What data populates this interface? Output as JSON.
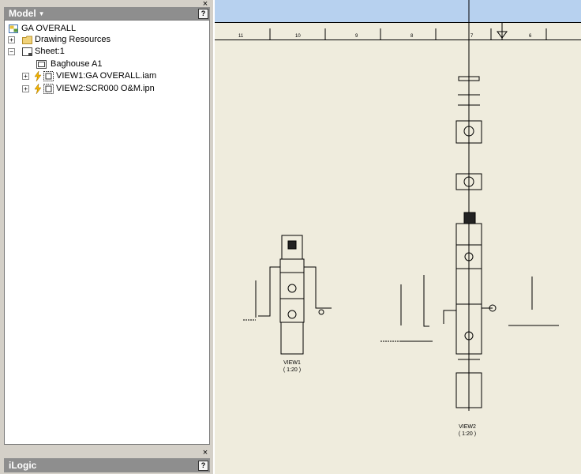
{
  "model_panel": {
    "title": "Model",
    "help": "?",
    "close": "×",
    "tree": [
      {
        "label": "GA OVERALL"
      },
      {
        "label": "Drawing Resources",
        "expander": "+"
      },
      {
        "label": "Sheet:1",
        "expander": "−"
      },
      {
        "label": "Baghouse A1"
      },
      {
        "label": "VIEW1:GA OVERALL.iam",
        "expander": "+"
      },
      {
        "label": "VIEW2:SCR000 O&M.ipn",
        "expander": "+"
      }
    ]
  },
  "ilogic_panel": {
    "title": "iLogic",
    "help": "?",
    "close": "×"
  },
  "ruler": {
    "labels": [
      "11",
      "10",
      "9",
      "8",
      "7",
      "6"
    ]
  },
  "views": {
    "view1": {
      "name": "VIEW1",
      "scale": "( 1:20 )"
    },
    "view2": {
      "name": "VIEW2",
      "scale": "( 1:20 )"
    }
  },
  "colors": {
    "panel_header": "#8e8e8e",
    "canvas_background": "#efecdd",
    "sky": "#b7d1ef"
  }
}
